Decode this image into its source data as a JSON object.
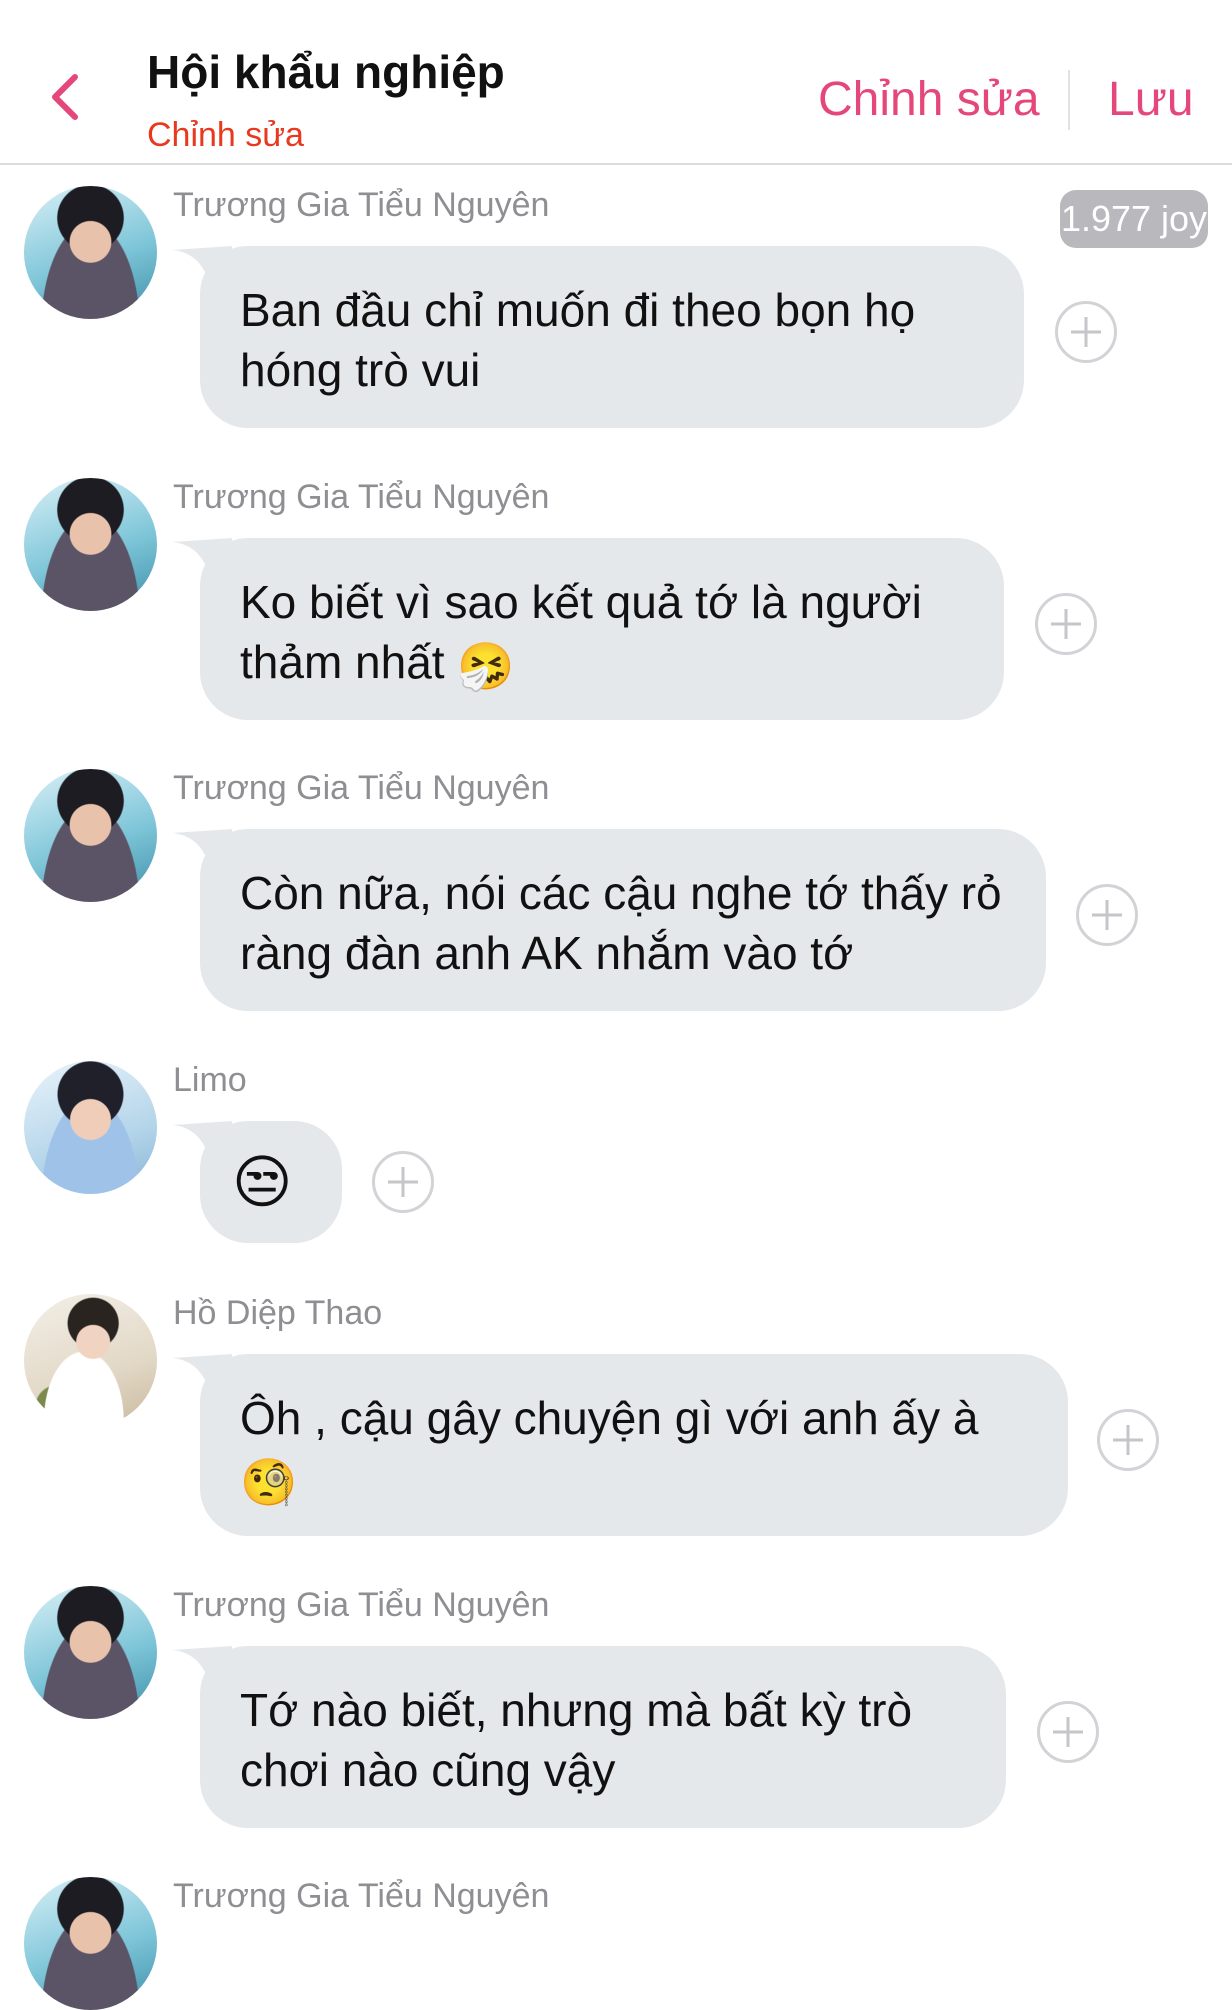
{
  "header": {
    "back_label": "<",
    "title": "Hội khẩu nghiệp",
    "subtitle": "Chỉnh sửa",
    "edit_label": "Chỉnh sửa",
    "save_label": "Lưu"
  },
  "joy_badge": "1.977 joy",
  "messages": [
    {
      "sender": "Trương Gia Tiểu Nguyên",
      "text": "Ban đầu chỉ muốn đi theo bọn họ hóng trò vui",
      "emoji": "",
      "avatar": "avatar-truong-gia-tieu-nguyen"
    },
    {
      "sender": "Trương Gia Tiểu Nguyên",
      "text": "Ko biết vì sao kết quả tớ là người thảm nhất",
      "emoji": "🤧",
      "avatar": "avatar-truong-gia-tieu-nguyen"
    },
    {
      "sender": "Trương Gia Tiểu Nguyên",
      "text": "Còn nữa, nói các cậu nghe tớ thấy rỏ ràng đàn anh AK nhắm vào tớ",
      "emoji": "",
      "avatar": "avatar-truong-gia-tieu-nguyen"
    },
    {
      "sender": "Limo",
      "text": "😒",
      "emoji": "",
      "avatar": "avatar-limo"
    },
    {
      "sender": "Hồ Diệp Thao",
      "text": "Ôh , cậu gây chuyện gì với anh ấy à",
      "emoji": "🧐",
      "avatar": "avatar-ho-diep-thao"
    },
    {
      "sender": "Trương Gia Tiểu Nguyên",
      "text": "Tớ nào biết, nhưng mà bất kỳ trò chơi nào cũng vậy",
      "emoji": "",
      "avatar": "avatar-truong-gia-tieu-nguyen"
    },
    {
      "sender": "Trương Gia Tiểu Nguyên",
      "text": "",
      "emoji": "",
      "avatar": "avatar-truong-gia-tieu-nguyen"
    }
  ],
  "colors": {
    "accent": "#e6477a",
    "subtitle": "#e8391f",
    "bubble": "#e5e8eb",
    "sender": "#8e8e93"
  }
}
